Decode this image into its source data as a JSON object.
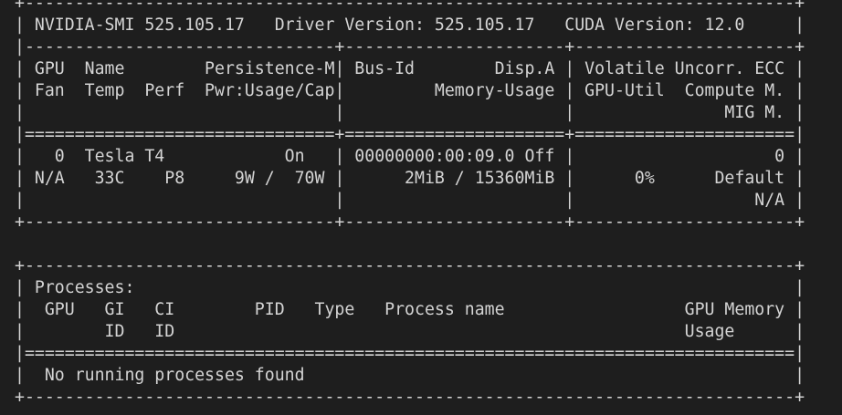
{
  "terminal": {
    "lines": [
      "+-----------------------------------------------------------------------------+",
      "| NVIDIA-SMI 525.105.17   Driver Version: 525.105.17   CUDA Version: 12.0     |",
      "|-------------------------------+----------------------+----------------------+",
      "| GPU  Name        Persistence-M| Bus-Id        Disp.A | Volatile Uncorr. ECC |",
      "| Fan  Temp  Perf  Pwr:Usage/Cap|         Memory-Usage | GPU-Util  Compute M. |",
      "|                               |                      |               MIG M. |",
      "|===============================+======================+======================|",
      "|   0  Tesla T4            On   | 00000000:00:09.0 Off |                    0 |",
      "| N/A   33C    P8     9W /  70W |      2MiB / 15360MiB |      0%      Default |",
      "|                               |                      |                  N/A |",
      "+-------------------------------+----------------------+----------------------+",
      "                                                                               ",
      "+-----------------------------------------------------------------------------+",
      "| Processes:                                                                  |",
      "|  GPU   GI   CI        PID   Type   Process name                  GPU Memory |",
      "|        ID   ID                                                   Usage      |",
      "|=============================================================================|",
      "|  No running processes found                                                 |",
      "+-----------------------------------------------------------------------------+"
    ]
  }
}
